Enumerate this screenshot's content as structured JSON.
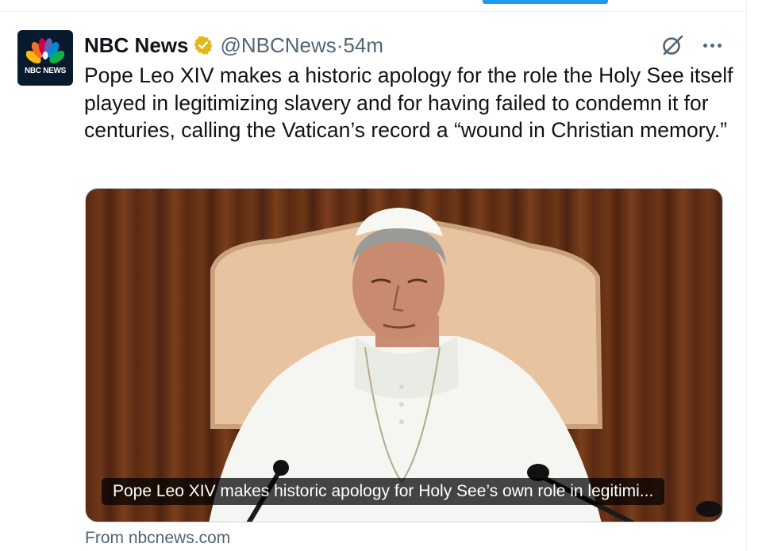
{
  "tweet": {
    "display_name": "NBC News",
    "handle": "@NBCNews",
    "time": "54m",
    "separator": "·",
    "text": "Pope Leo XIV makes a historic apology for the role the Holy See itself played in legitimizing slavery and for having failed to condemn it for centuries, calling the Vatican’s record a “wound in Christian memory.”",
    "avatar_label": "NBC NEWS"
  },
  "card": {
    "caption": "Pope Leo XIV makes historic apology for Holy See’s own role in legitimi...",
    "source": "From nbcnews.com"
  },
  "colors": {
    "accent": "#1d9bf0",
    "verified_gold": "#e2b719",
    "secondary_text": "#536471"
  },
  "icons": [
    "nbc-peacock-icon",
    "verified-badge-icon",
    "grok-icon",
    "more-icon"
  ]
}
